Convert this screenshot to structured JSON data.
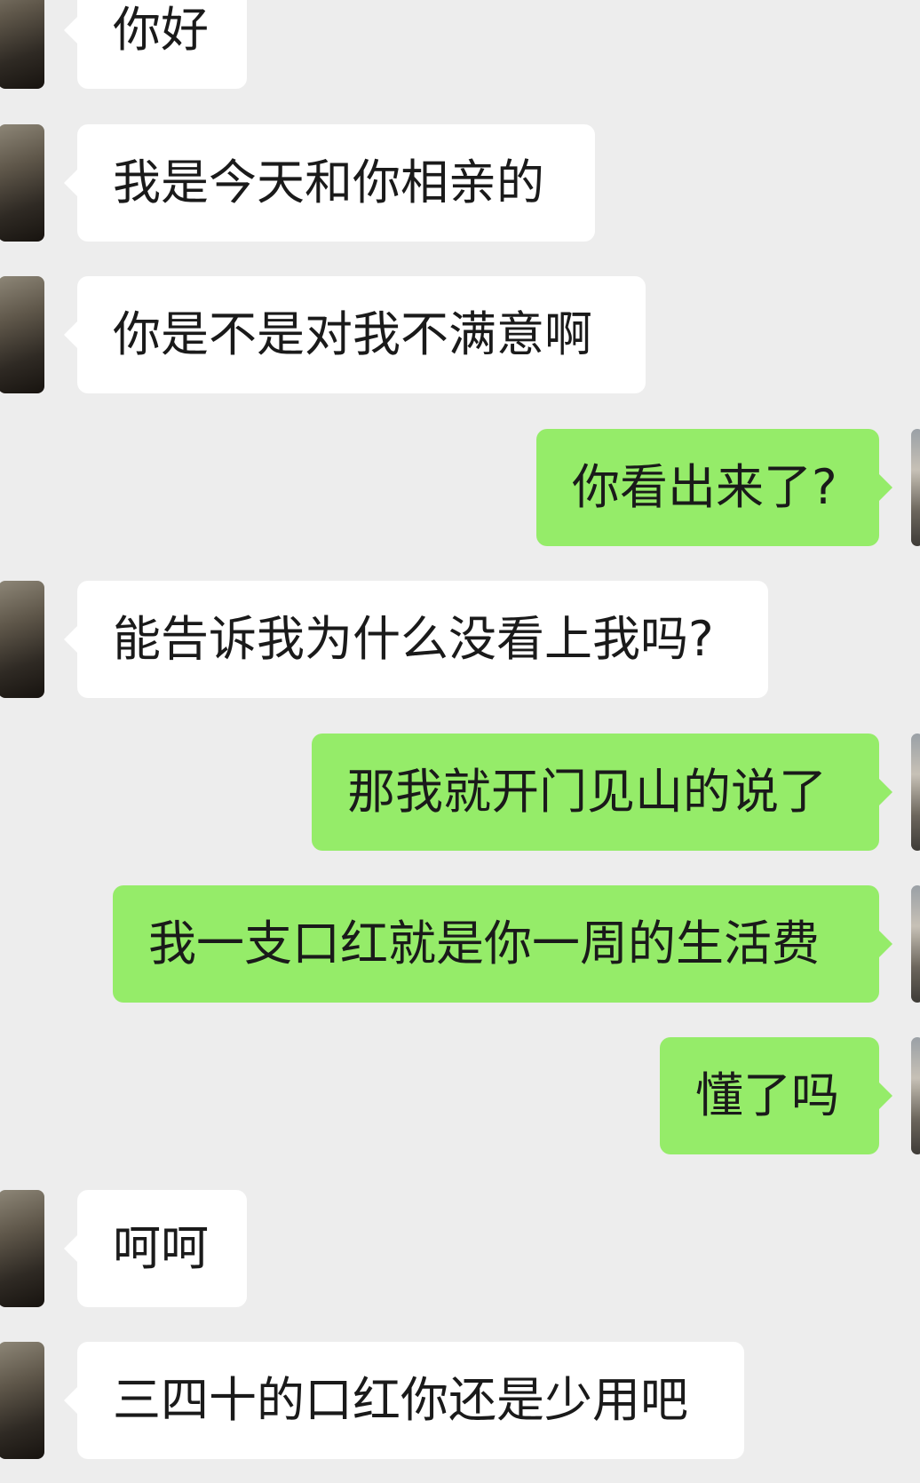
{
  "chat": {
    "messages": [
      {
        "side": "left",
        "text": "你好"
      },
      {
        "side": "left",
        "text": "我是今天和你相亲的"
      },
      {
        "side": "left",
        "text": "你是不是对我不满意啊"
      },
      {
        "side": "right",
        "text": "你看出来了?"
      },
      {
        "side": "left",
        "text": "能告诉我为什么没看上我吗?"
      },
      {
        "side": "right",
        "text": "那我就开门见山的说了"
      },
      {
        "side": "right",
        "text": "我一支口红就是你一周的生活费"
      },
      {
        "side": "right",
        "text": "懂了吗"
      },
      {
        "side": "left",
        "text": "呵呵"
      },
      {
        "side": "left",
        "text": "三四十的口红你还是少用吧"
      }
    ]
  },
  "colors": {
    "background": "#ededed",
    "incoming_bubble": "#ffffff",
    "outgoing_bubble": "#95ec69"
  },
  "icons": {
    "contact_avatar": "contact-avatar-icon",
    "self_avatar": "self-avatar-icon"
  }
}
